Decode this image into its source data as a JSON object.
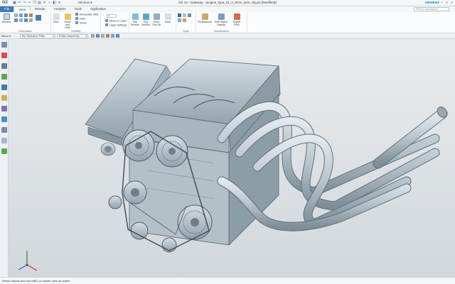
{
  "app": {
    "logo": "NX",
    "window_menu": "Window ▾",
    "title": "NX 10 - Gateway - [engine_type_01_2_8mm_asm_cfg.prt (Modified)]",
    "brand": "SIEMENS"
  },
  "tabs": [
    "File",
    "View",
    "Render",
    "Analysis",
    "Tools",
    "Application"
  ],
  "active_tab": "View",
  "find": {
    "placeholder": "Find a Command"
  },
  "ribbon": {
    "orientation": {
      "label": "Orientation",
      "buttons": [
        {
          "label": "Window"
        }
      ]
    },
    "show_hide": {
      "label": "Visibility",
      "buttons": [
        {
          "label": "Show and Hide"
        }
      ],
      "rows": [
        "Immediate Hide",
        "Hide",
        "Show"
      ],
      "more": "More"
    },
    "layers": {
      "zoom_value": "1",
      "rows": [
        "Move to Layer",
        "Layer Settings"
      ]
    },
    "section": {
      "buttons": [
        {
          "label": "Edit Section"
        },
        {
          "label": "Clip Section"
        },
        {
          "label": "Show Thru All"
        },
        {
          "label": "More"
        }
      ]
    },
    "style": {
      "label": "Style"
    },
    "visualization": {
      "label": "Visualization",
      "buttons": [
        {
          "label": "Professional"
        },
        {
          "label": "Edit Object Display"
        },
        {
          "label": "Export PNG"
        }
      ]
    }
  },
  "selbar": {
    "menu": "Menu ▾",
    "filter": "No Selection Filter",
    "scope": "Entire Assembly"
  },
  "status": {
    "text": "Select objects and use MB3, or double-click an object"
  },
  "colors": {
    "accent": "#3b7bb8",
    "model": "#b6c3cc",
    "brand": "#1a8aa8"
  }
}
